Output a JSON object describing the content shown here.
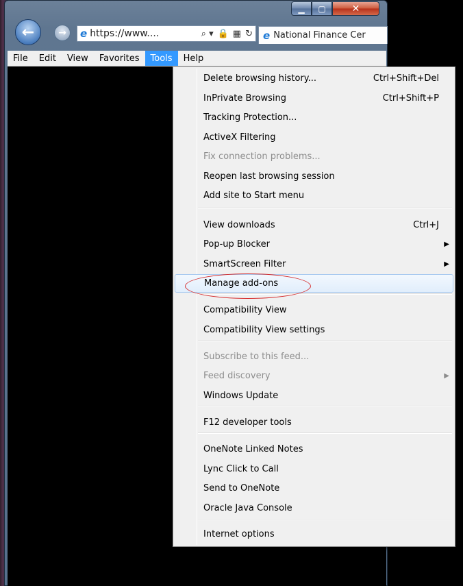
{
  "window": {
    "caption": {
      "minimize": "▁",
      "maximize": "▢",
      "close": "✕"
    }
  },
  "nav": {
    "back_icon": "←",
    "forward_icon": "→",
    "address": "https://www....",
    "address_controls": [
      "⌕ ▾",
      "🔒",
      "▦",
      "↻"
    ],
    "tab_title": "National Finance Cer"
  },
  "menubar": {
    "items": [
      "File",
      "Edit",
      "View",
      "Favorites",
      "Tools",
      "Help"
    ],
    "active": "Tools"
  },
  "tools_menu": {
    "items": [
      {
        "label": "Delete browsing history...",
        "shortcut": "Ctrl+Shift+Del"
      },
      {
        "label": "InPrivate Browsing",
        "shortcut": "Ctrl+Shift+P"
      },
      {
        "label": "Tracking Protection..."
      },
      {
        "label": "ActiveX Filtering"
      },
      {
        "label": "Fix connection problems...",
        "disabled": true
      },
      {
        "label": "Reopen last browsing session"
      },
      {
        "label": "Add site to Start menu"
      },
      {
        "label": "View downloads",
        "shortcut": "Ctrl+J"
      },
      {
        "label": "Pop-up Blocker",
        "submenu": true
      },
      {
        "label": "SmartScreen Filter",
        "submenu": true
      },
      {
        "label": "Manage add-ons",
        "highlighted": true
      },
      {
        "label": "Compatibility View"
      },
      {
        "label": "Compatibility View settings"
      },
      {
        "label": "Subscribe to this feed...",
        "disabled": true
      },
      {
        "label": "Feed discovery",
        "disabled": true,
        "submenu": true
      },
      {
        "label": "Windows Update"
      },
      {
        "label": "F12 developer tools"
      },
      {
        "label": "OneNote Linked Notes"
      },
      {
        "label": "Lync Click to Call"
      },
      {
        "label": "Send to OneNote"
      },
      {
        "label": "Oracle Java Console"
      },
      {
        "label": "Internet options"
      }
    ],
    "submenu_arrow": "▶"
  },
  "colors": {
    "menu_active_bg": "#3399ff",
    "annotation_circle": "#d62e2e",
    "disabled_text": "#8d8d8d"
  }
}
